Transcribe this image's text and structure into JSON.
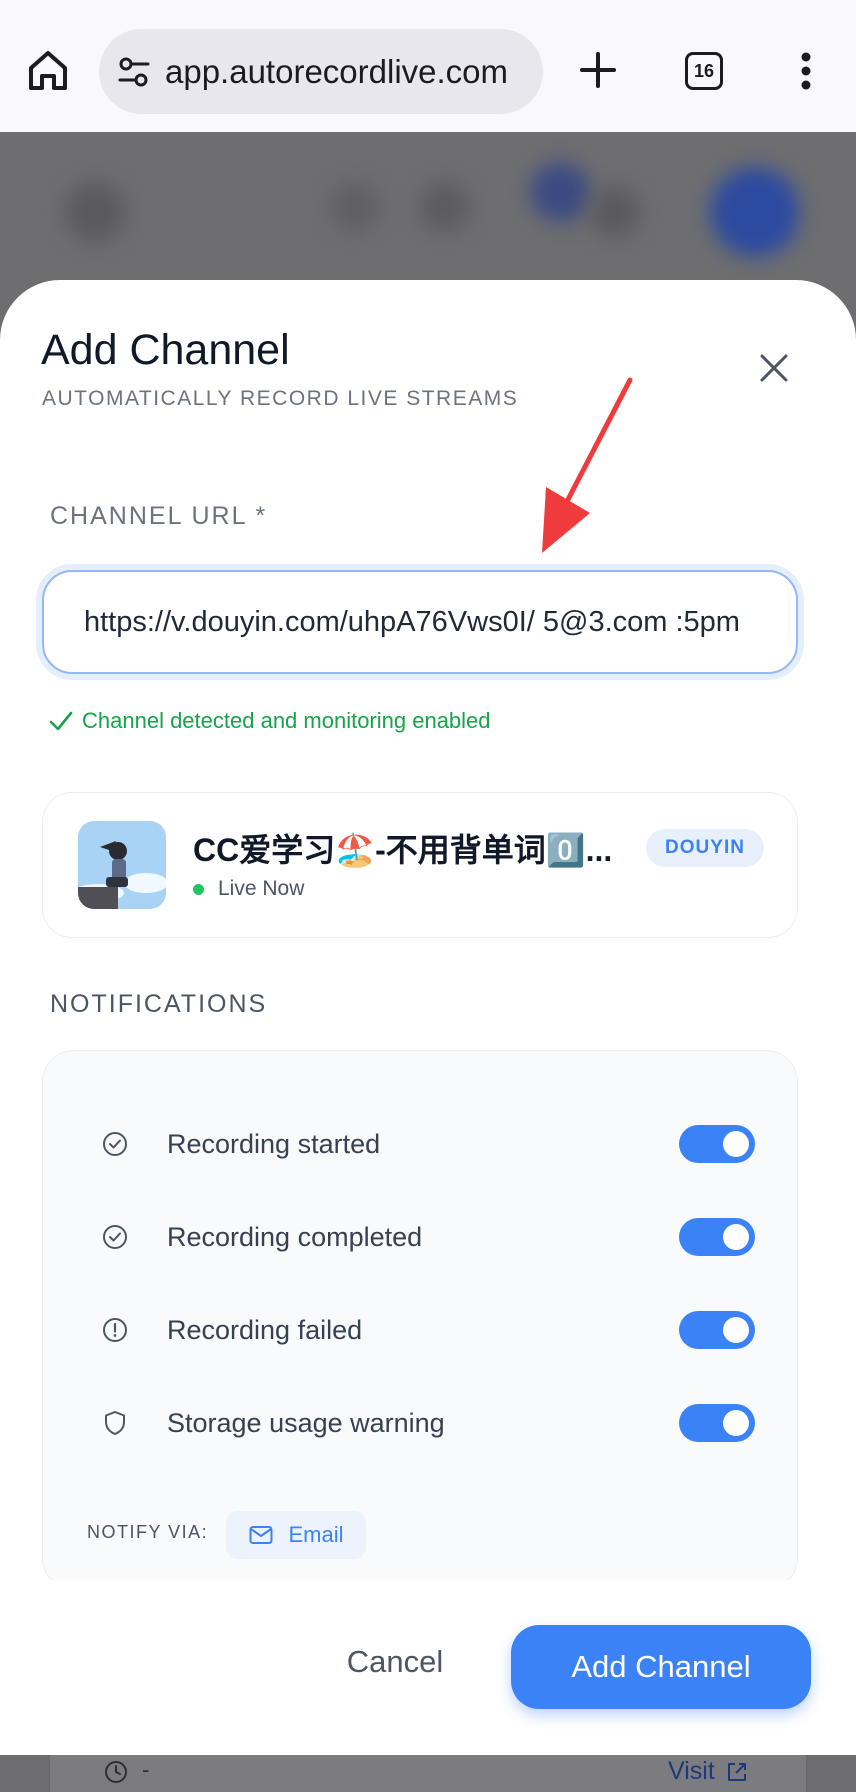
{
  "browser": {
    "url": "app.autorecordlive.com",
    "tab_count": "16"
  },
  "dialog": {
    "title": "Add Channel",
    "subtitle": "AUTOMATICALLY RECORD LIVE STREAMS",
    "channel_url_label": "CHANNEL URL *",
    "channel_url_value": "https://v.douyin.com/uhpA76Vws0I/ 5@3.com :5pm",
    "detected_message": "Channel detected and monitoring enabled",
    "channel": {
      "name": "CC爱学习🏖️-不用背单词0️⃣...",
      "status": "Live Now",
      "platform": "DOUYIN"
    },
    "notifications_label": "NOTIFICATIONS",
    "notifications": [
      {
        "label": "Recording started",
        "icon": "check-circle-icon",
        "enabled": true
      },
      {
        "label": "Recording completed",
        "icon": "check-circle-icon",
        "enabled": true
      },
      {
        "label": "Recording failed",
        "icon": "alert-circle-icon",
        "enabled": true
      },
      {
        "label": "Storage usage warning",
        "icon": "shield-icon",
        "enabled": true
      }
    ],
    "notify_via_label": "NOTIFY VIA:",
    "notify_via_channel": "Email",
    "cancel_label": "Cancel",
    "submit_label": "Add Channel"
  },
  "background_row": {
    "time_value": "-",
    "visit_label": "Visit"
  },
  "colors": {
    "accent": "#3b82f6",
    "success": "#16a34a",
    "live_dot": "#22c55e",
    "annotation_arrow": "#ef3b3b"
  }
}
